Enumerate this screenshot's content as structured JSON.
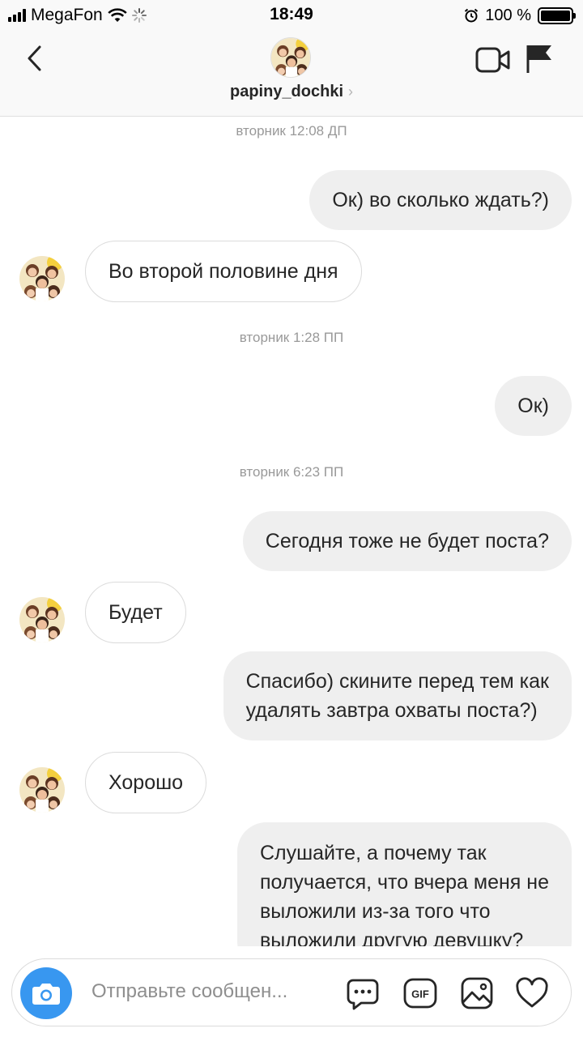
{
  "status_bar": {
    "carrier": "MegaFon",
    "time": "18:49",
    "battery_text": "100 %",
    "battery_level": 1.0
  },
  "header": {
    "username": "papiny_dochki",
    "chevron": "›",
    "icons": [
      "back-chevron-icon",
      "video-call-icon",
      "flag-icon"
    ]
  },
  "messages": [
    {
      "type": "timestamp",
      "text": "вторник 12:08 ДП"
    },
    {
      "type": "outgoing",
      "text": "Ок) во сколько ждать?)"
    },
    {
      "type": "incoming",
      "text": "Во второй половине дня"
    },
    {
      "type": "timestamp",
      "text": "вторник 1:28 ПП"
    },
    {
      "type": "outgoing",
      "text": "Ок)"
    },
    {
      "type": "timestamp",
      "text": "вторник 6:23 ПП"
    },
    {
      "type": "outgoing",
      "text": "Сегодня тоже не будет поста?"
    },
    {
      "type": "incoming",
      "text": "Будет"
    },
    {
      "type": "outgoing",
      "lines": [
        "Спасибо) скините перед тем как",
        "удалять завтра охваты поста?)"
      ]
    },
    {
      "type": "incoming",
      "text": "Хорошо"
    },
    {
      "type": "outgoing",
      "lines": [
        "Слушайте, а почему так",
        "получается, что вчера меня не",
        "выложили из-за того что",
        "выложили другую девушку?"
      ]
    }
  ],
  "composer": {
    "placeholder": "Отправьте сообщен...",
    "gif_label": "GIF",
    "icons": [
      "camera-icon",
      "chat-bubble-icon",
      "gif-icon",
      "gallery-icon",
      "heart-icon"
    ]
  },
  "colors": {
    "accent": "#3897f0",
    "outgoing_bubble": "#efefef",
    "incoming_border": "#dbdbdb",
    "timestamp": "#999999",
    "header_bg": "#f9f9f9"
  }
}
